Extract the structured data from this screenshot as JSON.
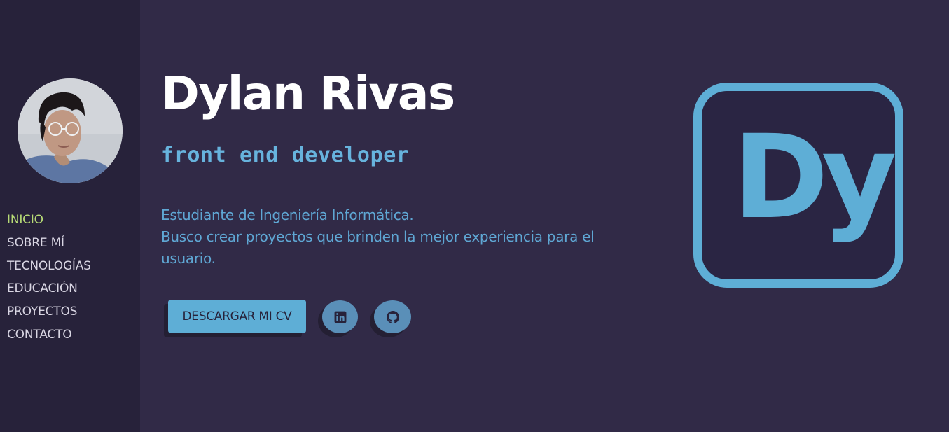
{
  "profile": {
    "name": "Dylan Rivas",
    "role": "front end developer",
    "description_line1": "Estudiante de Ingeniería Informática.",
    "description_line2": "Busco crear proyectos que brinden la mejor experiencia para el usuario."
  },
  "nav": {
    "items": [
      {
        "label": "INICIO",
        "active": true
      },
      {
        "label": "SOBRE MÍ"
      },
      {
        "label": "TECNOLOGÍAS"
      },
      {
        "label": "EDUCACIÓN"
      },
      {
        "label": "PROYECTOS"
      },
      {
        "label": "CONTACTO"
      }
    ]
  },
  "actions": {
    "cv_label": "DESCARGAR MI CV",
    "linkedin_icon": "linkedin-icon",
    "github_icon": "github-icon"
  },
  "logo": {
    "text": "Dy"
  },
  "colors": {
    "background": "#312a47",
    "sidebar": "#27223a",
    "accent": "#5eaed6",
    "active_nav": "#b7db76"
  }
}
